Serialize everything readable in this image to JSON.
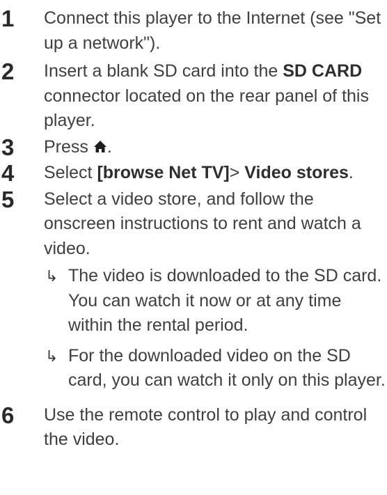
{
  "steps": [
    {
      "num": "1",
      "text": "Connect this player to the Internet (see \"Set up a network\")."
    },
    {
      "num": "2",
      "pre": "Insert a blank SD card into the ",
      "bold": "SD CARD",
      "post": " connector located on the rear panel of this player."
    },
    {
      "num": "3",
      "pre": "Press ",
      "post": "."
    },
    {
      "num": "4",
      "pre": "Select ",
      "bold1": "[browse Net TV]",
      "mid": "> ",
      "bold2": "Video stores",
      "post": "."
    },
    {
      "num": "5",
      "text": "Select a video store, and follow the onscreen instructions to rent and watch a video.",
      "subs": [
        "The video is downloaded to the SD card. You can watch it now or at any time within the rental period.",
        "For the downloaded video on the SD card, you can watch it only on this player."
      ]
    },
    {
      "num": "6",
      "text": "Use the remote control to play and control the video."
    }
  ],
  "icons": {
    "home": "home-icon",
    "result_arrow": "result-arrow-icon"
  }
}
